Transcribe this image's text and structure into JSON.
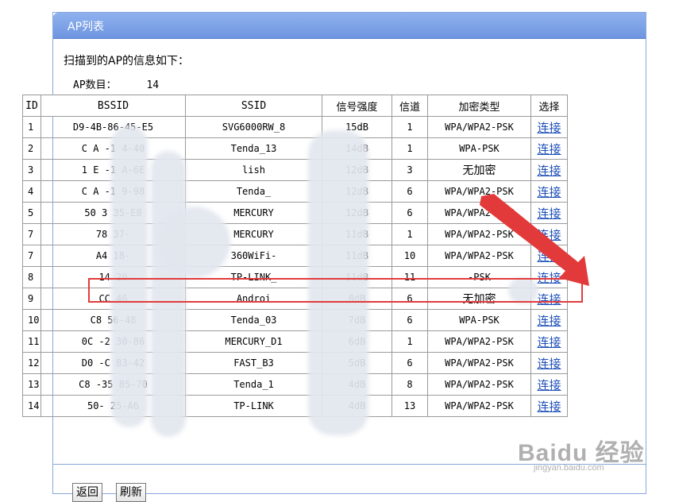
{
  "window": {
    "title": "AP列表"
  },
  "scan_info": "扫描到的AP的信息如下：",
  "ap_count": {
    "label": "AP数目：",
    "value": "14"
  },
  "table": {
    "headers": [
      "ID",
      "BSSID",
      "SSID",
      "信号强度",
      "信道",
      "加密类型",
      "选择"
    ],
    "rows": [
      {
        "id": "1",
        "bssid": "D9-4B-86-45-E5",
        "ssid": "SVG6000RW_8",
        "signal": "15dB",
        "channel": "1",
        "encryption": "WPA/WPA2-PSK",
        "select": "连接"
      },
      {
        "id": "2",
        "bssid": "C  A  -1  4-40",
        "ssid": "Tenda_13",
        "signal": "14dB",
        "channel": "1",
        "encryption": "WPA-PSK",
        "select": "连接"
      },
      {
        "id": "3",
        "bssid": "1  E  -1  A-6E",
        "ssid": "lish",
        "signal": "12dB",
        "channel": "3",
        "encryption": "无加密",
        "select": "连接"
      },
      {
        "id": "4",
        "bssid": "C  A  -1  9-98",
        "ssid": "Tenda_",
        "signal": "12dB",
        "channel": "6",
        "encryption": "WPA/WPA2-PSK",
        "select": "连接"
      },
      {
        "id": "5",
        "bssid": "50  3  35-E8",
        "ssid": "MERCURY",
        "signal": "12dB",
        "channel": "6",
        "encryption": "WPA/WPA2-PSK",
        "select": "连接"
      },
      {
        "id": "7",
        "bssid": "78  37-",
        "ssid": "MERCURY",
        "signal": "11dB",
        "channel": "1",
        "encryption": "WPA/WPA2-PSK",
        "select": "连接"
      },
      {
        "id": "7",
        "bssid": "A4  18-",
        "ssid": "360WiFi-",
        "signal": "11dB",
        "channel": "10",
        "encryption": "WPA/WPA2-PSK",
        "select": "连接"
      },
      {
        "id": "8",
        "bssid": "14  20",
        "ssid": "TP-LINK_",
        "signal": "11dB",
        "channel": "11",
        "encryption": "-PSK",
        "select": "连接"
      },
      {
        "id": "9",
        "bssid": "CC  46",
        "ssid": "Androi",
        "signal": "8dB",
        "channel": "6",
        "encryption": "无加密",
        "select": "连接"
      },
      {
        "id": "10",
        "bssid": "C8  56-48",
        "ssid": "Tenda_03",
        "signal": "7dB",
        "channel": "6",
        "encryption": "WPA-PSK",
        "select": "连接"
      },
      {
        "id": "11",
        "bssid": "0C  -2  30-86",
        "ssid": "MERCURY_D1",
        "signal": "6dB",
        "channel": "1",
        "encryption": "WPA/WPA2-PSK",
        "select": "连接"
      },
      {
        "id": "12",
        "bssid": "D0  -C  B3-42",
        "ssid": "FAST_B3",
        "signal": "5dB",
        "channel": "6",
        "encryption": "WPA/WPA2-PSK",
        "select": "连接"
      },
      {
        "id": "13",
        "bssid": "C8  -35  85-70",
        "ssid": "Tenda_1",
        "signal": "4dB",
        "channel": "8",
        "encryption": "WPA/WPA2-PSK",
        "select": "连接"
      },
      {
        "id": "14",
        "bssid": "50-  25-A6",
        "ssid": "TP-LINK",
        "signal": "4dB",
        "channel": "13",
        "encryption": "WPA/WPA2-PSK",
        "select": "连接"
      }
    ]
  },
  "buttons": {
    "back": "返回",
    "refresh": "刷新"
  },
  "watermark": {
    "logo": "Baidu 经验",
    "url": "jingyan.baidu.com"
  },
  "colors": {
    "titlebar": "#7ea2e6",
    "link": "#1d4fb8",
    "highlight": "#e33b3b"
  }
}
